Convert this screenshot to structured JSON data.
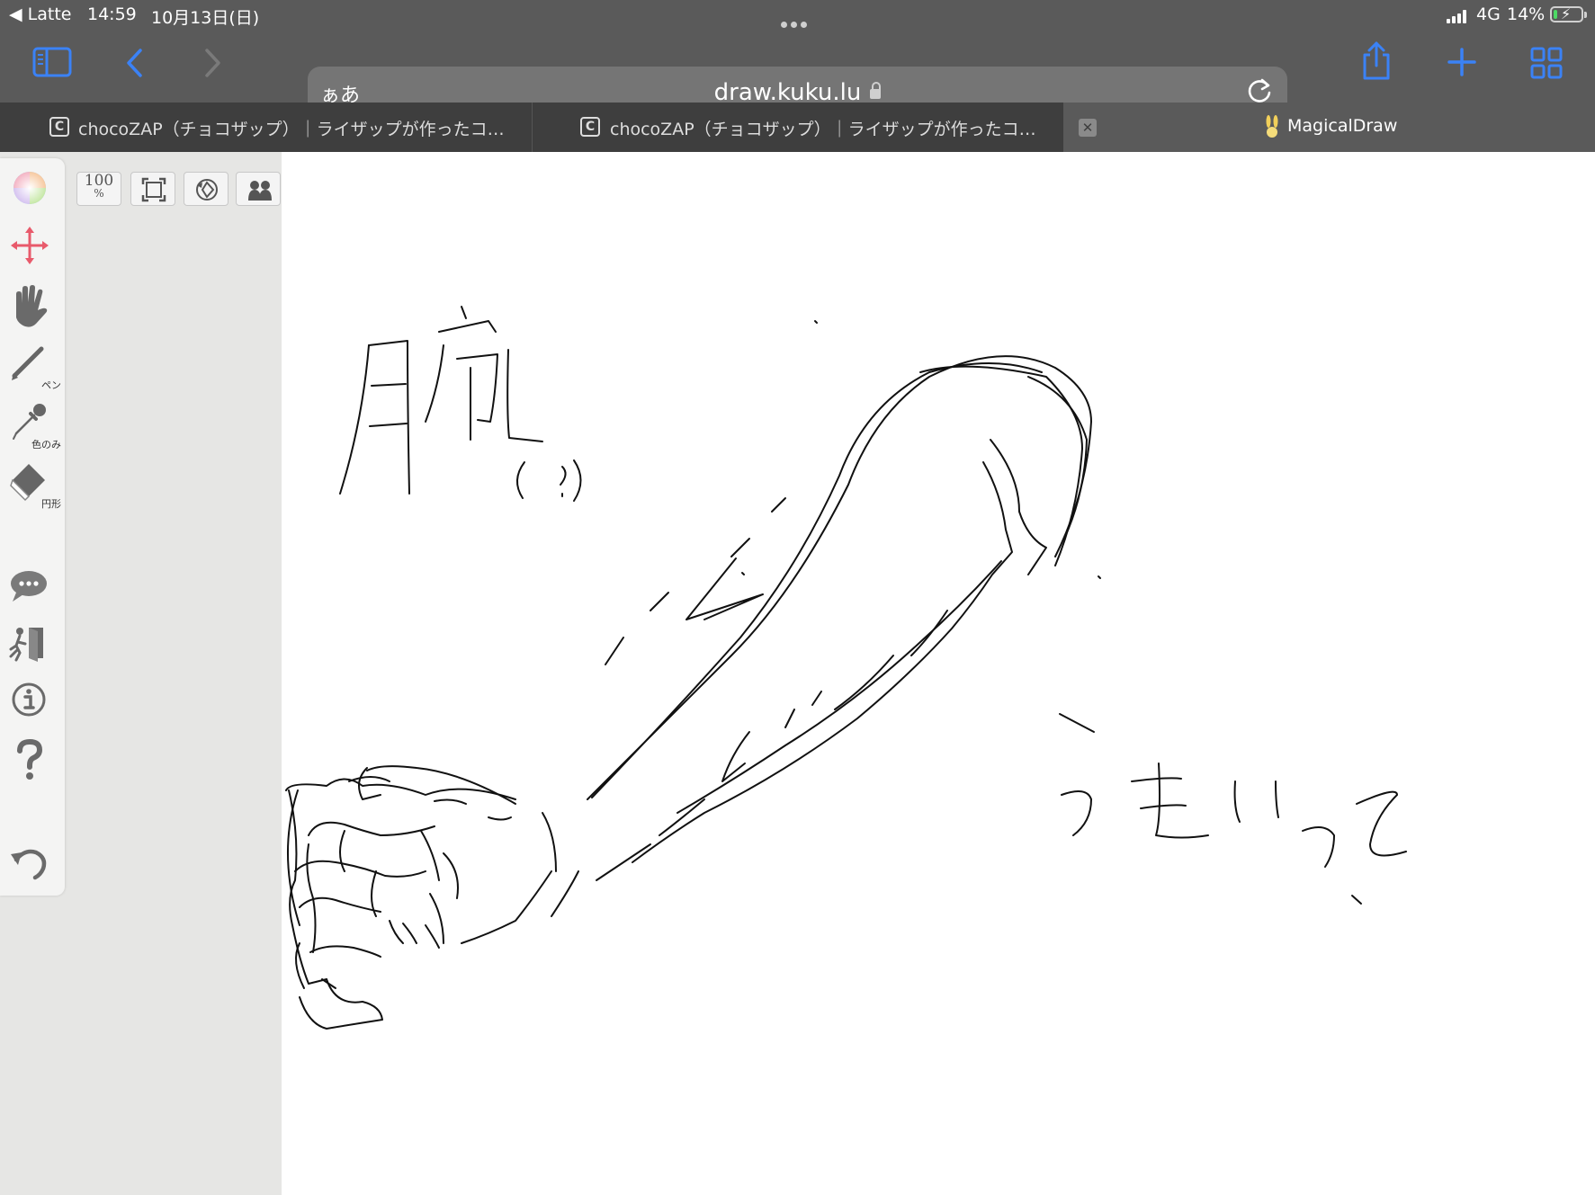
{
  "status_bar": {
    "back_app": "◀ Latte",
    "time": "14:59",
    "date": "10月13日(日)",
    "network": "4G",
    "battery": "14%",
    "battery_level": 0.14
  },
  "toolbar": {
    "url_prefix": "ぁあ",
    "url": "draw.kuku.lu"
  },
  "tabs": [
    {
      "favicon": "C",
      "title": "chocoZAP（チョコザップ）｜ライザップが作ったコ…"
    },
    {
      "favicon": "C",
      "title": "chocoZAP（チョコザップ）｜ライザップが作ったコ…"
    },
    {
      "favicon": "rabbit-icon",
      "title": "MagicalDraw",
      "active": true
    }
  ],
  "app": {
    "zoom": "100",
    "zoom_unit": "%",
    "sidebar_labels": {
      "pen": "ペン",
      "color_only": "色のみ",
      "circle": "円形"
    }
  },
  "colors": {
    "browser_chrome": "#5a5a5a",
    "tab_bar": "#3e3e3e",
    "accent": "#3b82f6",
    "move_tool": "#e85a6b",
    "left_pane": "#e6e6e4",
    "ink": "#111111"
  }
}
